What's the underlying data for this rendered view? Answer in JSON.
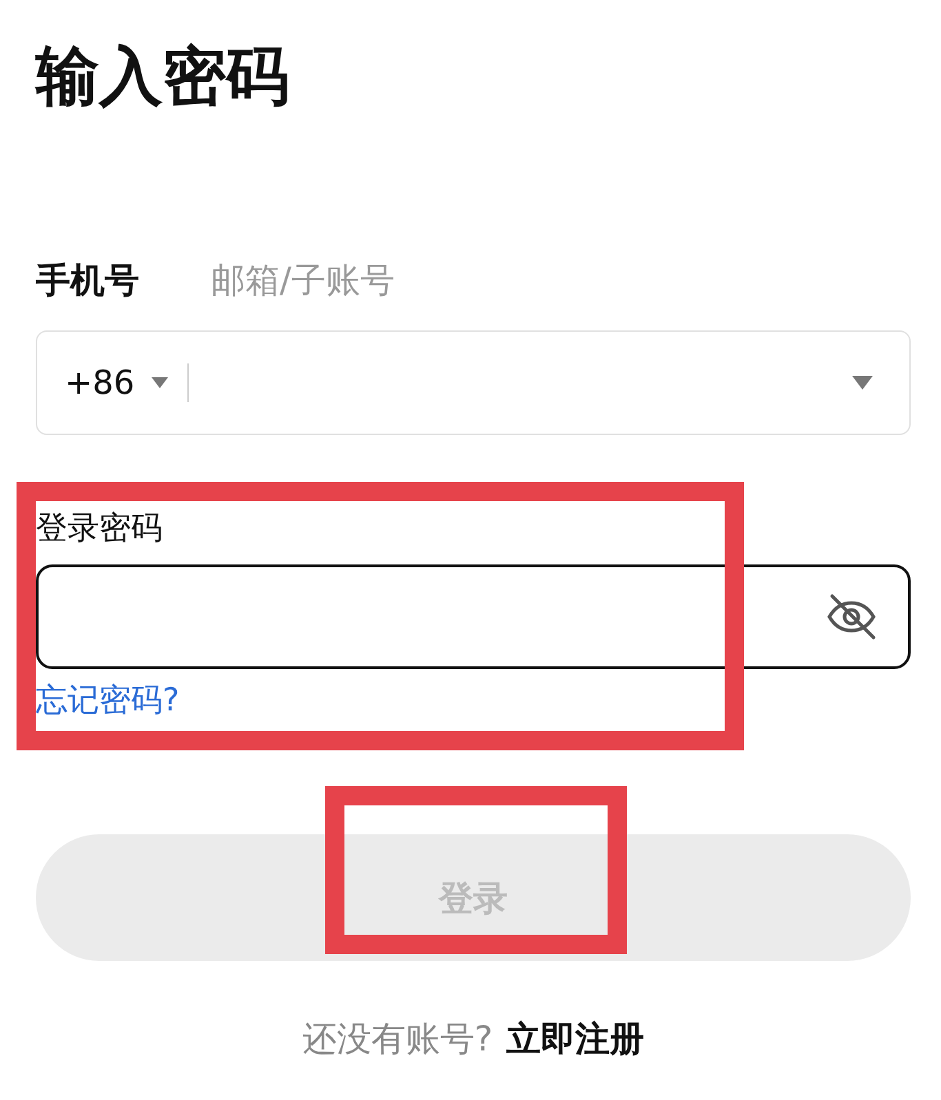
{
  "title": "输入密码",
  "tabs": [
    {
      "label": "手机号",
      "selected": true
    },
    {
      "label": "邮箱/子账号",
      "selected": false
    }
  ],
  "phone_field": {
    "country_code": "+86"
  },
  "password": {
    "label": "登录密码",
    "forgot_link": "忘记密码?",
    "highlighted": true
  },
  "login_button": {
    "label": "登录",
    "disabled": true,
    "highlighted": true
  },
  "signup": {
    "prompt": "还没有账号?",
    "link": "立即注册"
  }
}
